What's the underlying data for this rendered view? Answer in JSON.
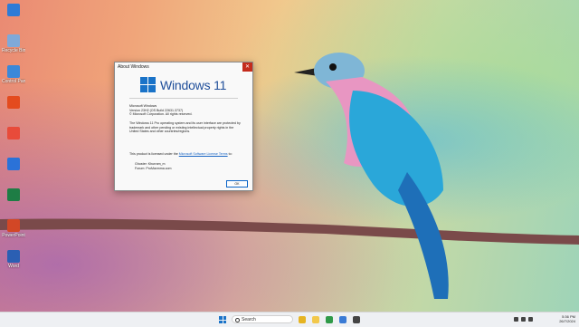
{
  "desktop": {
    "icons": [
      {
        "label": "",
        "color": "#2e7bd6"
      },
      {
        "label": "Recycle Bin",
        "color": "#7fa9d9"
      },
      {
        "label": "Control Panel",
        "color": "#3b88d9"
      },
      {
        "label": "",
        "color": "#e44b1e"
      },
      {
        "label": "",
        "color": "#e84b3a"
      },
      {
        "label": "",
        "color": "#2b72d8"
      },
      {
        "label": "",
        "color": "#1e7d45"
      },
      {
        "label": "PowerPoint",
        "color": "#d24726"
      },
      {
        "label": "Word",
        "color": "#2b5fb3"
      }
    ]
  },
  "dialog": {
    "title": "About Windows",
    "close_glyph": "✕",
    "logo_text": "Windows 11",
    "product": "Microsoft Windows",
    "version": "Version 23H2 (OS Build 22631.3737)",
    "copyright": "© Microsoft Corporation. All rights reserved.",
    "description": "The Windows 11 Pro operating system and its user interface are protected by trademark and other pending or existing intellectual property rights in the United States and other countries/regions.",
    "license_prefix": "This product is licensed under the",
    "license_link": "Microsoft Software License Terms",
    "license_suffix": "to:",
    "owner1": "Ghoster: Khurram_m",
    "owner2": "Forum: ProMaxmma.com",
    "ok_label": "OK"
  },
  "taskbar": {
    "search_placeholder": "Search",
    "apps": [
      {
        "name": "file-explorer",
        "color": "#e6b422"
      },
      {
        "name": "folder",
        "color": "#f2c84b"
      },
      {
        "name": "chrome",
        "color": "#2f9a48"
      },
      {
        "name": "store",
        "color": "#3a7bd5"
      },
      {
        "name": "terminal",
        "color": "#444444"
      }
    ],
    "time": "5:36 PM",
    "date": "26/7/2024"
  }
}
